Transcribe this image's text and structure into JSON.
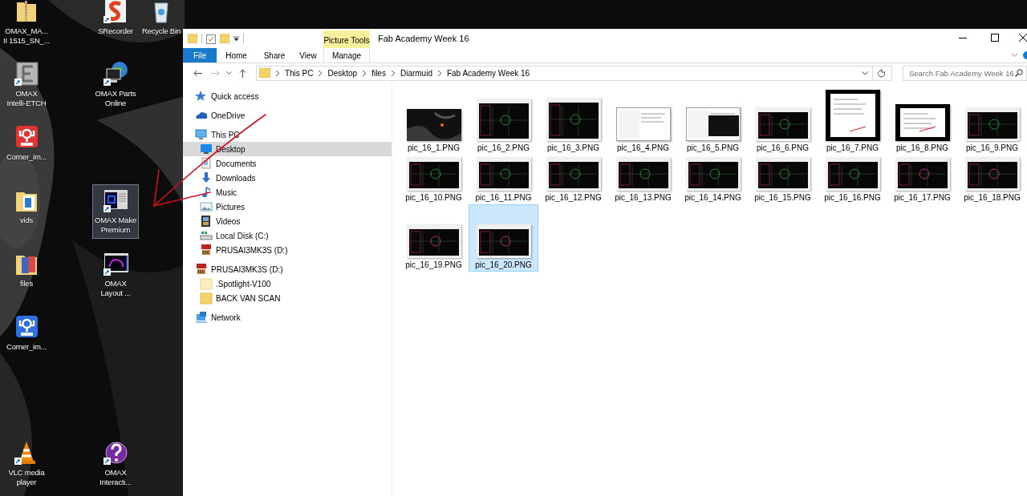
{
  "desktop": {
    "icons": [
      {
        "label": "OMAX_MA...\nII 1515_SN_...",
        "selected": false
      },
      {
        "label": "SRecorder",
        "selected": false
      },
      {
        "label": "Recycle Bin",
        "selected": false
      },
      {
        "label": "OMAX\nIntelli-ETCH",
        "selected": false
      },
      {
        "label": "OMAX Parts\nOnline",
        "selected": false
      },
      {
        "label": "Corner_im...",
        "selected": false
      },
      {
        "label": "vids",
        "selected": false
      },
      {
        "label": "OMAX Make\nPremium",
        "selected": true
      },
      {
        "label": "files",
        "selected": false
      },
      {
        "label": "OMAX\nLayout ...",
        "selected": false
      },
      {
        "label": "Corner_im...",
        "selected": false
      },
      {
        "label": "VLC media\nplayer",
        "selected": false
      },
      {
        "label": "OMAX\nInteracti...",
        "selected": false
      }
    ]
  },
  "window": {
    "title": "Fab Academy Week 16",
    "contextual_group": "Picture Tools",
    "ribbon_tabs": [
      {
        "label": "File",
        "kind": "file"
      },
      {
        "label": "Home",
        "kind": "tab"
      },
      {
        "label": "Share",
        "kind": "tab"
      },
      {
        "label": "View",
        "kind": "tab"
      },
      {
        "label": "Manage",
        "kind": "contextual"
      }
    ]
  },
  "address_bar": {
    "breadcrumbs": [
      "This PC",
      "Desktop",
      "files",
      "Diarmuid",
      "Fab Academy Week 16"
    ]
  },
  "search": {
    "placeholder": "Search Fab Academy Week 16"
  },
  "navigation": [
    {
      "label": "Quick access",
      "selected": false
    },
    {
      "label": "OneDrive",
      "selected": false
    },
    {
      "label": "This PC",
      "selected": false,
      "children": [
        {
          "label": "Desktop",
          "selected": true
        },
        {
          "label": "Documents",
          "selected": false
        },
        {
          "label": "Downloads",
          "selected": false
        },
        {
          "label": "Music",
          "selected": false
        },
        {
          "label": "Pictures",
          "selected": false
        },
        {
          "label": "Videos",
          "selected": false
        },
        {
          "label": "Local Disk (C:)",
          "selected": false
        },
        {
          "label": "PRUSAI3MK3S (D:)",
          "selected": false
        }
      ]
    },
    {
      "label": "PRUSAI3MK3S (D:)",
      "selected": false,
      "children": [
        {
          "label": ".Spotlight-V100",
          "selected": false
        },
        {
          "label": "BACK VAN SCAN",
          "selected": false
        }
      ]
    },
    {
      "label": "Network",
      "selected": false
    }
  ],
  "files": [
    {
      "name": "pic_16_1.PNG",
      "selected": false
    },
    {
      "name": "pic_16_2.PNG",
      "selected": false
    },
    {
      "name": "pic_16_3.PNG",
      "selected": false
    },
    {
      "name": "pic_16_4.PNG",
      "selected": false
    },
    {
      "name": "pic_16_5.PNG",
      "selected": false
    },
    {
      "name": "pic_16_6.PNG",
      "selected": false
    },
    {
      "name": "pic_16_7.PNG",
      "selected": false
    },
    {
      "name": "pic_16_8.PNG",
      "selected": false
    },
    {
      "name": "pic_16_9.PNG",
      "selected": false
    },
    {
      "name": "pic_16_10.PNG",
      "selected": false
    },
    {
      "name": "pic_16_11.PNG",
      "selected": false
    },
    {
      "name": "pic_16_12.PNG",
      "selected": false
    },
    {
      "name": "pic_16_13.PNG",
      "selected": false
    },
    {
      "name": "pic_16_14.PNG",
      "selected": false
    },
    {
      "name": "pic_16_15.PNG",
      "selected": false
    },
    {
      "name": "pic_16_16.PNG",
      "selected": false
    },
    {
      "name": "pic_16_17.PNG",
      "selected": false
    },
    {
      "name": "pic_16_18.PNG",
      "selected": false
    },
    {
      "name": "pic_16_19.PNG",
      "selected": false
    },
    {
      "name": "pic_16_20.PNG",
      "selected": true
    }
  ]
}
